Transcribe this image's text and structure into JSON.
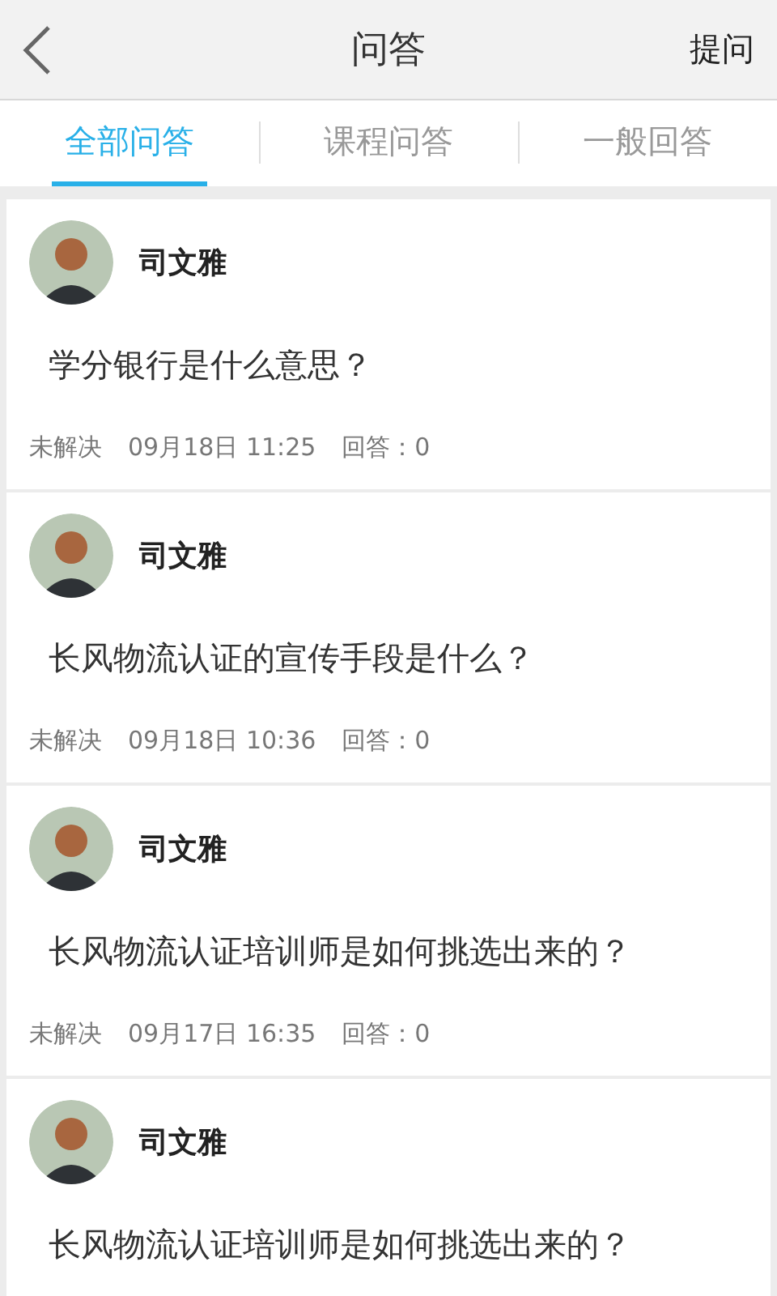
{
  "header": {
    "title": "问答",
    "action": "提问"
  },
  "tabs": [
    {
      "label": "全部问答",
      "selected": true
    },
    {
      "label": "课程问答",
      "selected": false
    },
    {
      "label": "一般回答",
      "selected": false
    }
  ],
  "questions": [
    {
      "author": "司文雅",
      "question": "学分银行是什么意思？",
      "status": "未解决",
      "time": "09月18日 11:25",
      "answers": "回答：0"
    },
    {
      "author": "司文雅",
      "question": "长风物流认证的宣传手段是什么？",
      "status": "未解决",
      "time": "09月18日 10:36",
      "answers": "回答：0"
    },
    {
      "author": "司文雅",
      "question": "长风物流认证培训师是如何挑选出来的？",
      "status": "未解决",
      "time": "09月17日 16:35",
      "answers": "回答：0"
    },
    {
      "author": "司文雅",
      "question": "长风物流认证培训师是如何挑选出来的？"
    }
  ]
}
